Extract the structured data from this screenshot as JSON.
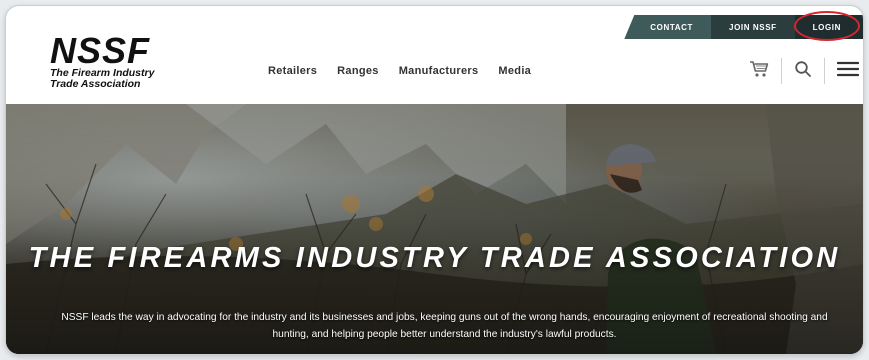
{
  "topbar": {
    "contact": "CONTACT",
    "join": "JOIN NSSF",
    "login": "LOGIN",
    "accent": "#d6262e"
  },
  "logo": {
    "mark": "NSSF",
    "tagline_line1": "The Firearm Industry",
    "tagline_line2": "Trade Association"
  },
  "nav": {
    "items": [
      "Retailers",
      "Ranges",
      "Manufacturers",
      "Media"
    ]
  },
  "tools": {
    "cart_icon": "cart-icon",
    "search_icon": "search-icon",
    "menu_icon": "hamburger-menu-icon"
  },
  "hero": {
    "headline": "THE FIREARMS INDUSTRY TRADE ASSOCIATION",
    "subtext": "NSSF leads the way in advocating for the industry and its businesses and jobs, keeping guns out of the wrong hands, encouraging enjoyment of recreational shooting and hunting, and helping people better understand the industry's lawful products."
  }
}
